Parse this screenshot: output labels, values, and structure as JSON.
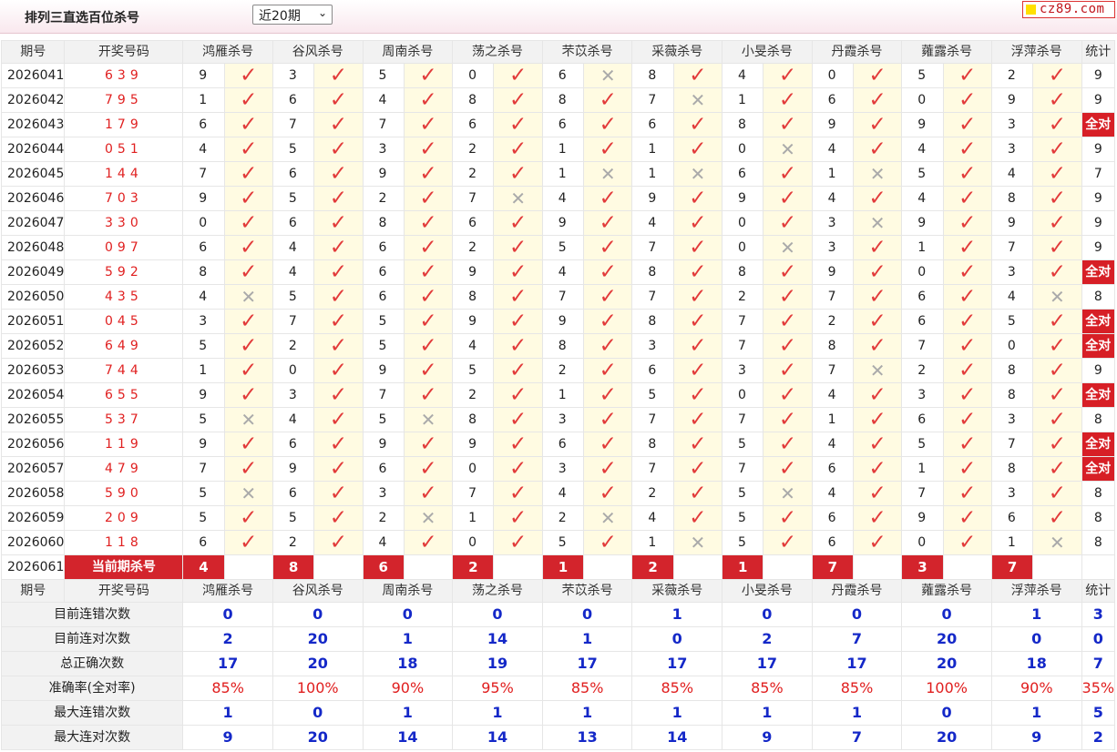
{
  "header": {
    "title": "排列三直选百位杀号",
    "period_option": "近20期",
    "period_arrow": "⌄",
    "logo_text": "cz89.com"
  },
  "columns": {
    "issue": "期号",
    "draw": "开奖号码",
    "experts": [
      "鸿雁杀号",
      "谷风杀号",
      "周南杀号",
      "荡之杀号",
      "芣苡杀号",
      "采薇杀号",
      "小旻杀号",
      "丹霞杀号",
      "蕹露杀号",
      "浮萍杀号"
    ],
    "stat": "统计"
  },
  "marks": {
    "correct": "✓",
    "wrong": "✕",
    "correct_color": "#e23a3a",
    "wrong_color": "#aaaaaa"
  },
  "colors": {
    "accent_red": "#d3242c",
    "stat_blue": "#1428c8",
    "highlight_bg": "#fffbe2"
  },
  "rows": [
    {
      "issue": "2026041",
      "draw": "639",
      "picks": [
        [
          9,
          1
        ],
        [
          3,
          1
        ],
        [
          5,
          1
        ],
        [
          0,
          1
        ],
        [
          6,
          0
        ],
        [
          8,
          1
        ],
        [
          4,
          1
        ],
        [
          0,
          1
        ],
        [
          5,
          1
        ],
        [
          2,
          1
        ]
      ],
      "stat": "9"
    },
    {
      "issue": "2026042",
      "draw": "795",
      "picks": [
        [
          1,
          1
        ],
        [
          6,
          1
        ],
        [
          4,
          1
        ],
        [
          8,
          1
        ],
        [
          8,
          1
        ],
        [
          7,
          0
        ],
        [
          1,
          1
        ],
        [
          6,
          1
        ],
        [
          0,
          1
        ],
        [
          9,
          1
        ]
      ],
      "stat": "9"
    },
    {
      "issue": "2026043",
      "draw": "179",
      "picks": [
        [
          6,
          1
        ],
        [
          7,
          1
        ],
        [
          7,
          1
        ],
        [
          6,
          1
        ],
        [
          6,
          1
        ],
        [
          6,
          1
        ],
        [
          8,
          1
        ],
        [
          9,
          1
        ],
        [
          9,
          1
        ],
        [
          3,
          1
        ]
      ],
      "stat": "全对"
    },
    {
      "issue": "2026044",
      "draw": "051",
      "picks": [
        [
          4,
          1
        ],
        [
          5,
          1
        ],
        [
          3,
          1
        ],
        [
          2,
          1
        ],
        [
          1,
          1
        ],
        [
          1,
          1
        ],
        [
          0,
          0
        ],
        [
          4,
          1
        ],
        [
          4,
          1
        ],
        [
          3,
          1
        ]
      ],
      "stat": "9"
    },
    {
      "issue": "2026045",
      "draw": "144",
      "picks": [
        [
          7,
          1
        ],
        [
          6,
          1
        ],
        [
          9,
          1
        ],
        [
          2,
          1
        ],
        [
          1,
          0
        ],
        [
          1,
          0
        ],
        [
          6,
          1
        ],
        [
          1,
          0
        ],
        [
          5,
          1
        ],
        [
          4,
          1
        ]
      ],
      "stat": "7"
    },
    {
      "issue": "2026046",
      "draw": "703",
      "picks": [
        [
          9,
          1
        ],
        [
          5,
          1
        ],
        [
          2,
          1
        ],
        [
          7,
          0
        ],
        [
          4,
          1
        ],
        [
          9,
          1
        ],
        [
          9,
          1
        ],
        [
          4,
          1
        ],
        [
          4,
          1
        ],
        [
          8,
          1
        ]
      ],
      "stat": "9"
    },
    {
      "issue": "2026047",
      "draw": "330",
      "picks": [
        [
          0,
          1
        ],
        [
          6,
          1
        ],
        [
          8,
          1
        ],
        [
          6,
          1
        ],
        [
          9,
          1
        ],
        [
          4,
          1
        ],
        [
          0,
          1
        ],
        [
          3,
          0
        ],
        [
          9,
          1
        ],
        [
          9,
          1
        ]
      ],
      "stat": "9"
    },
    {
      "issue": "2026048",
      "draw": "097",
      "picks": [
        [
          6,
          1
        ],
        [
          4,
          1
        ],
        [
          6,
          1
        ],
        [
          2,
          1
        ],
        [
          5,
          1
        ],
        [
          7,
          1
        ],
        [
          0,
          0
        ],
        [
          3,
          1
        ],
        [
          1,
          1
        ],
        [
          7,
          1
        ]
      ],
      "stat": "9"
    },
    {
      "issue": "2026049",
      "draw": "592",
      "picks": [
        [
          8,
          1
        ],
        [
          4,
          1
        ],
        [
          6,
          1
        ],
        [
          9,
          1
        ],
        [
          4,
          1
        ],
        [
          8,
          1
        ],
        [
          8,
          1
        ],
        [
          9,
          1
        ],
        [
          0,
          1
        ],
        [
          3,
          1
        ]
      ],
      "stat": "全对"
    },
    {
      "issue": "2026050",
      "draw": "435",
      "picks": [
        [
          4,
          0
        ],
        [
          5,
          1
        ],
        [
          6,
          1
        ],
        [
          8,
          1
        ],
        [
          7,
          1
        ],
        [
          7,
          1
        ],
        [
          2,
          1
        ],
        [
          7,
          1
        ],
        [
          6,
          1
        ],
        [
          4,
          0
        ]
      ],
      "stat": "8"
    },
    {
      "issue": "2026051",
      "draw": "045",
      "picks": [
        [
          3,
          1
        ],
        [
          7,
          1
        ],
        [
          5,
          1
        ],
        [
          9,
          1
        ],
        [
          9,
          1
        ],
        [
          8,
          1
        ],
        [
          7,
          1
        ],
        [
          2,
          1
        ],
        [
          6,
          1
        ],
        [
          5,
          1
        ]
      ],
      "stat": "全对"
    },
    {
      "issue": "2026052",
      "draw": "649",
      "picks": [
        [
          5,
          1
        ],
        [
          2,
          1
        ],
        [
          5,
          1
        ],
        [
          4,
          1
        ],
        [
          8,
          1
        ],
        [
          3,
          1
        ],
        [
          7,
          1
        ],
        [
          8,
          1
        ],
        [
          7,
          1
        ],
        [
          0,
          1
        ]
      ],
      "stat": "全对"
    },
    {
      "issue": "2026053",
      "draw": "744",
      "picks": [
        [
          1,
          1
        ],
        [
          0,
          1
        ],
        [
          9,
          1
        ],
        [
          5,
          1
        ],
        [
          2,
          1
        ],
        [
          6,
          1
        ],
        [
          3,
          1
        ],
        [
          7,
          0
        ],
        [
          2,
          1
        ],
        [
          8,
          1
        ]
      ],
      "stat": "9"
    },
    {
      "issue": "2026054",
      "draw": "655",
      "picks": [
        [
          9,
          1
        ],
        [
          3,
          1
        ],
        [
          7,
          1
        ],
        [
          2,
          1
        ],
        [
          1,
          1
        ],
        [
          5,
          1
        ],
        [
          0,
          1
        ],
        [
          4,
          1
        ],
        [
          3,
          1
        ],
        [
          8,
          1
        ]
      ],
      "stat": "全对"
    },
    {
      "issue": "2026055",
      "draw": "537",
      "picks": [
        [
          5,
          0
        ],
        [
          4,
          1
        ],
        [
          5,
          0
        ],
        [
          8,
          1
        ],
        [
          3,
          1
        ],
        [
          7,
          1
        ],
        [
          7,
          1
        ],
        [
          1,
          1
        ],
        [
          6,
          1
        ],
        [
          3,
          1
        ]
      ],
      "stat": "8"
    },
    {
      "issue": "2026056",
      "draw": "119",
      "picks": [
        [
          9,
          1
        ],
        [
          6,
          1
        ],
        [
          9,
          1
        ],
        [
          9,
          1
        ],
        [
          6,
          1
        ],
        [
          8,
          1
        ],
        [
          5,
          1
        ],
        [
          4,
          1
        ],
        [
          5,
          1
        ],
        [
          7,
          1
        ]
      ],
      "stat": "全对"
    },
    {
      "issue": "2026057",
      "draw": "479",
      "picks": [
        [
          7,
          1
        ],
        [
          9,
          1
        ],
        [
          6,
          1
        ],
        [
          0,
          1
        ],
        [
          3,
          1
        ],
        [
          7,
          1
        ],
        [
          7,
          1
        ],
        [
          6,
          1
        ],
        [
          1,
          1
        ],
        [
          8,
          1
        ]
      ],
      "stat": "全对"
    },
    {
      "issue": "2026058",
      "draw": "590",
      "picks": [
        [
          5,
          0
        ],
        [
          6,
          1
        ],
        [
          3,
          1
        ],
        [
          7,
          1
        ],
        [
          4,
          1
        ],
        [
          2,
          1
        ],
        [
          5,
          0
        ],
        [
          4,
          1
        ],
        [
          7,
          1
        ],
        [
          3,
          1
        ]
      ],
      "stat": "8"
    },
    {
      "issue": "2026059",
      "draw": "209",
      "picks": [
        [
          5,
          1
        ],
        [
          5,
          1
        ],
        [
          2,
          0
        ],
        [
          1,
          1
        ],
        [
          2,
          0
        ],
        [
          4,
          1
        ],
        [
          5,
          1
        ],
        [
          6,
          1
        ],
        [
          9,
          1
        ],
        [
          6,
          1
        ]
      ],
      "stat": "8"
    },
    {
      "issue": "2026060",
      "draw": "118",
      "picks": [
        [
          6,
          1
        ],
        [
          2,
          1
        ],
        [
          4,
          1
        ],
        [
          0,
          1
        ],
        [
          5,
          1
        ],
        [
          1,
          0
        ],
        [
          5,
          1
        ],
        [
          6,
          1
        ],
        [
          0,
          1
        ],
        [
          1,
          0
        ]
      ],
      "stat": "8"
    }
  ],
  "current": {
    "issue": "2026061",
    "label": "当前期杀号",
    "kills": [
      "4",
      "8",
      "6",
      "2",
      "1",
      "2",
      "1",
      "7",
      "3",
      "7"
    ]
  },
  "summary": [
    {
      "label": "目前连错次数",
      "values": [
        "0",
        "0",
        "0",
        "0",
        "0",
        "1",
        "0",
        "0",
        "0",
        "1"
      ],
      "stat": "3"
    },
    {
      "label": "目前连对次数",
      "values": [
        "2",
        "20",
        "1",
        "14",
        "1",
        "0",
        "2",
        "7",
        "20",
        "0"
      ],
      "stat": "0"
    },
    {
      "label": "总正确次数",
      "values": [
        "17",
        "20",
        "18",
        "19",
        "17",
        "17",
        "17",
        "17",
        "20",
        "18"
      ],
      "stat": "7"
    },
    {
      "label": "准确率(全对率)",
      "values": [
        "85%",
        "100%",
        "90%",
        "95%",
        "85%",
        "85%",
        "85%",
        "85%",
        "100%",
        "90%"
      ],
      "stat": "35%",
      "rate": true
    },
    {
      "label": "最大连错次数",
      "values": [
        "1",
        "0",
        "1",
        "1",
        "1",
        "1",
        "1",
        "1",
        "0",
        "1"
      ],
      "stat": "5"
    },
    {
      "label": "最大连对次数",
      "values": [
        "9",
        "20",
        "14",
        "14",
        "13",
        "14",
        "9",
        "7",
        "20",
        "9"
      ],
      "stat": "2"
    }
  ]
}
